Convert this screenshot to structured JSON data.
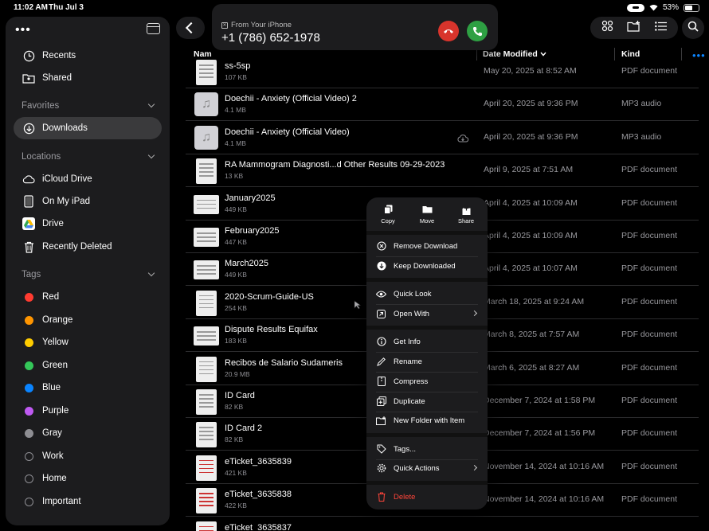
{
  "status": {
    "time": "11:02 AM",
    "date": "Thu Jul 3",
    "battery": "53%"
  },
  "call": {
    "from_label": "From Your iPhone",
    "number": "+1 (786) 652-1978"
  },
  "sidebar": {
    "items": [
      {
        "label": "Recents",
        "icon": "clock-icon"
      },
      {
        "label": "Shared",
        "icon": "shared-folder-icon"
      }
    ],
    "favorites_header": "Favorites",
    "favorites": [
      {
        "label": "Downloads",
        "icon": "download-icon",
        "active": true
      }
    ],
    "locations_header": "Locations",
    "locations": [
      {
        "label": "iCloud Drive",
        "icon": "cloud-icon"
      },
      {
        "label": "On My iPad",
        "icon": "ipad-icon"
      },
      {
        "label": "Drive",
        "icon": "google-drive-icon"
      },
      {
        "label": "Recently Deleted",
        "icon": "trash-icon"
      }
    ],
    "tags_header": "Tags",
    "tags": [
      {
        "label": "Red",
        "color": "#ff3b30"
      },
      {
        "label": "Orange",
        "color": "#ff9500"
      },
      {
        "label": "Yellow",
        "color": "#ffcc00"
      },
      {
        "label": "Green",
        "color": "#34c759"
      },
      {
        "label": "Blue",
        "color": "#0a84ff"
      },
      {
        "label": "Purple",
        "color": "#bf5af2"
      },
      {
        "label": "Gray",
        "color": "#8e8e93"
      },
      {
        "label": "Work",
        "color": ""
      },
      {
        "label": "Home",
        "color": ""
      },
      {
        "label": "Important",
        "color": ""
      }
    ]
  },
  "columns": {
    "name": "Nam",
    "date": "Date Modified",
    "kind": "Kind"
  },
  "files": [
    {
      "name": "ss-5sp",
      "size": "107 KB",
      "date": "May 20, 2025 at 8:52 AM",
      "kind": "PDF document",
      "thumb": "doc"
    },
    {
      "name": "Doechii - Anxiety (Official Video) 2",
      "size": "4.1 MB",
      "date": "April 20, 2025 at 9:36 PM",
      "kind": "MP3 audio",
      "thumb": "audio"
    },
    {
      "name": "Doechii - Anxiety (Official Video)",
      "size": "4.1 MB",
      "date": "April 20, 2025 at 9:36 PM",
      "kind": "MP3 audio",
      "thumb": "audio",
      "cloud": true
    },
    {
      "name": "RA Mammogram Diagnosti...d Other Results 09-29-2023",
      "size": "13 KB",
      "date": "April 9, 2025 at 7:51 AM",
      "kind": "PDF document",
      "thumb": "doc"
    },
    {
      "name": "January2025",
      "size": "449 KB",
      "date": "April 4, 2025 at 10:09 AM",
      "kind": "PDF document",
      "thumb": "wide"
    },
    {
      "name": "February2025",
      "size": "447 KB",
      "date": "April 4, 2025 at 10:09 AM",
      "kind": "PDF document",
      "thumb": "wide"
    },
    {
      "name": "March2025",
      "size": "449 KB",
      "date": "April 4, 2025 at 10:07 AM",
      "kind": "PDF document",
      "thumb": "wide"
    },
    {
      "name": "2020-Scrum-Guide-US",
      "size": "254 KB",
      "date": "March 18, 2025 at 9:24 AM",
      "kind": "PDF document",
      "thumb": "doc"
    },
    {
      "name": "Dispute Results Equifax",
      "size": "183 KB",
      "date": "March 8, 2025 at 7:57 AM",
      "kind": "PDF document",
      "thumb": "wide"
    },
    {
      "name": "Recibos de Salario Sudameris",
      "size": "20.9 MB",
      "date": "March 6, 2025 at 8:27 AM",
      "kind": "PDF document",
      "thumb": "doc"
    },
    {
      "name": "ID Card",
      "size": "82 KB",
      "date": "December 7, 2024 at 1:58 PM",
      "kind": "PDF document",
      "thumb": "doc"
    },
    {
      "name": "ID Card 2",
      "size": "82 KB",
      "date": "December 7, 2024 at 1:56 PM",
      "kind": "PDF document",
      "thumb": "doc"
    },
    {
      "name": "eTicket_3635839",
      "size": "421 KB",
      "date": "November 14, 2024 at 10:16 AM",
      "kind": "PDF document",
      "thumb": "ticket"
    },
    {
      "name": "eTicket_3635838",
      "size": "422 KB",
      "date": "November 14, 2024 at 10:16 AM",
      "kind": "PDF document",
      "thumb": "ticket"
    },
    {
      "name": "eTicket_3635837",
      "size": "",
      "date": "",
      "kind": "",
      "thumb": "ticket"
    }
  ],
  "context_menu": {
    "quick": [
      {
        "label": "Copy",
        "icon": "copy-icon"
      },
      {
        "label": "Move",
        "icon": "folder-icon"
      },
      {
        "label": "Share",
        "icon": "share-icon"
      }
    ],
    "group1": [
      {
        "label": "Remove Download",
        "icon": "x-circle-icon"
      },
      {
        "label": "Keep Downloaded",
        "icon": "download-circle-icon"
      }
    ],
    "group2": [
      {
        "label": "Quick Look",
        "icon": "eye-icon"
      },
      {
        "label": "Open With",
        "icon": "open-with-icon",
        "submenu": true
      }
    ],
    "group3": [
      {
        "label": "Get Info",
        "icon": "info-icon"
      },
      {
        "label": "Rename",
        "icon": "pencil-icon"
      },
      {
        "label": "Compress",
        "icon": "archive-icon"
      },
      {
        "label": "Duplicate",
        "icon": "duplicate-icon"
      },
      {
        "label": "New Folder with Item",
        "icon": "new-folder-icon"
      }
    ],
    "group4": [
      {
        "label": "Tags...",
        "icon": "tag-icon"
      },
      {
        "label": "Quick Actions",
        "icon": "gear-icon",
        "submenu": true
      }
    ],
    "delete": {
      "label": "Delete",
      "icon": "trash-icon"
    }
  }
}
